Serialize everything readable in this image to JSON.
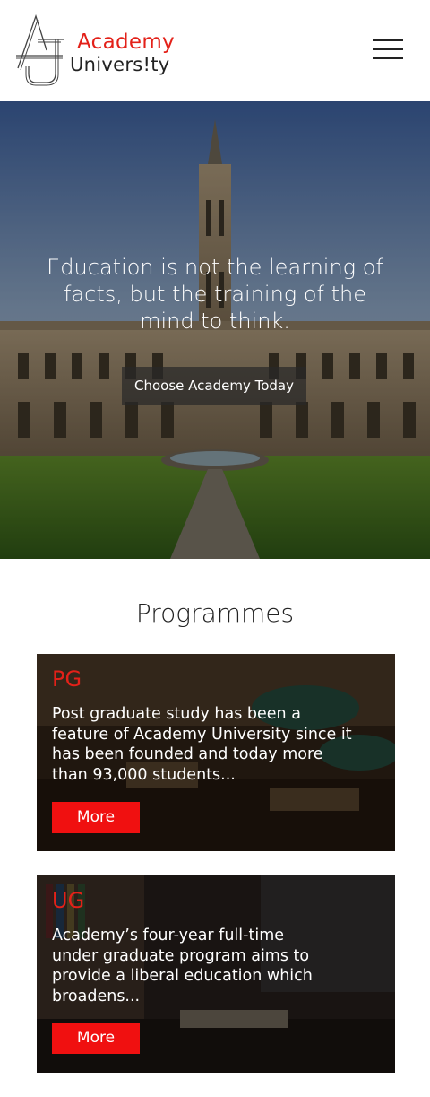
{
  "brand": {
    "name_line1": "Academy",
    "name_line2": "Univers!ty",
    "accent_color": "#e32119"
  },
  "header": {
    "menu_icon": "hamburger-menu-icon"
  },
  "hero": {
    "quote": "Education is not the learning of facts, but the training of the mind to think.",
    "cta_label": "Choose Academy Today"
  },
  "programmes": {
    "title": "Programmes",
    "cards": [
      {
        "title": "PG",
        "text": "Post graduate study has been a feature of Academy University since it has been founded and today more than 93,000 students...",
        "button": "More"
      },
      {
        "title": "UG",
        "text": "Academy’s four-year full-time under graduate program aims to provide a liberal education which broadens...",
        "button": "More"
      }
    ]
  }
}
